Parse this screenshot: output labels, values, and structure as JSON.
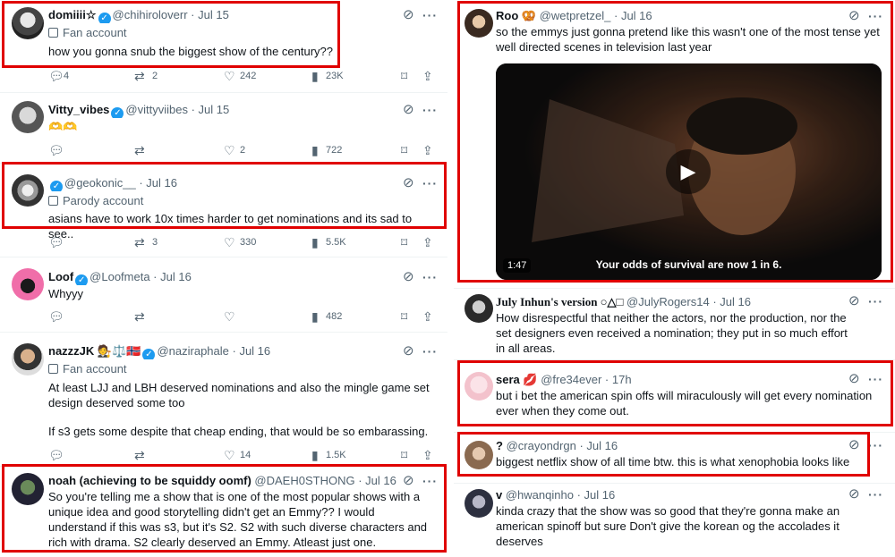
{
  "left": [
    {
      "name": "domiiii☆",
      "handle": "@chihiroloverr",
      "date": "Jul 15",
      "label": "Fan account",
      "text": "how you gonna snub the biggest show of the century??",
      "replies": "4",
      "reposts": "2",
      "likes": "242",
      "views": "23K"
    },
    {
      "name": "Vitty_vibes",
      "handle": "@vittyviibes",
      "date": "Jul 15",
      "text": "🫶🫶",
      "replies": "",
      "reposts": "",
      "likes": "2",
      "views": "722"
    },
    {
      "name": "",
      "handle": "@geokonic__",
      "date": "Jul 16",
      "label": "Parody account",
      "text": "asians have to work 10x times harder to get nominations and its sad to see..",
      "replies": "",
      "reposts": "3",
      "likes": "330",
      "views": "5.5K"
    },
    {
      "name": "Loof",
      "handle": "@Loofmeta",
      "date": "Jul 16",
      "text": "Whyyy",
      "replies": "",
      "reposts": "",
      "likes": "",
      "views": "482"
    },
    {
      "name": "nazzzJK 🧑‍⚖️⚖️🇳🇴",
      "handle": "@naziraphale",
      "date": "Jul 16",
      "label": "Fan account",
      "text": "At least LJJ and LBH deserved nominations and also the mingle game set design deserved some too",
      "text2": "If s3 gets some despite that cheap ending, that would be so embarassing.",
      "replies": "",
      "reposts": "",
      "likes": "14",
      "views": "1.5K"
    },
    {
      "name": "noah (achieving to be squiddy oomf)",
      "handle": "@DAEH0STHONG",
      "date": "Jul 16",
      "text": "So you're telling me a show that is one of the most popular shows  with a unique idea and good storytelling didn't get an Emmy?? I would understand if this was s3, but it's S2. S2 with such diverse characters and rich with drama. S2 clearly deserved an Emmy. Atleast just one."
    }
  ],
  "right": [
    {
      "name": "Roo 🥨",
      "handle": "@wetpretzel_",
      "date": "Jul 16",
      "text": "so the emmys just gonna pretend like this wasn't one of the most tense yet well directed scenes in television last year",
      "video_duration": "1:47",
      "video_caption": "Your odds of survival are now 1 in 6."
    },
    {
      "name": "July Inhun's version ○△□",
      "handle": "@JulyRogers14",
      "date": "Jul 16",
      "text": "How disrespectful that neither the actors, nor the production, nor the set designers even received a nomination; they put in so much effort in all areas."
    },
    {
      "name": "sera 💋",
      "handle": "@fre34ever",
      "date": "17h",
      "text": "but i bet the american spin offs will miraculously will get every nomination ever when they come out."
    },
    {
      "name": "?",
      "handle": "@crayondrgn",
      "date": "Jul 16",
      "text": "biggest netflix show of all time btw. this is what xenophobia looks like"
    },
    {
      "name": "v",
      "handle": "@hwanqinho",
      "date": "Jul 16",
      "text": "kinda crazy that the show was so good that they're gonna make an american spinoff but sure Don't give the korean og the accolades it deserves"
    }
  ],
  "icons": {
    "reply": "reply-icon",
    "repost": "repost-icon",
    "like": "heart-icon",
    "views": "views-icon",
    "bookmark": "bookmark-icon",
    "share": "share-icon",
    "grok": "grok-icon",
    "more": "more-icon"
  },
  "colors": {
    "highlight": "#e00000",
    "verified": "#1d9bf0",
    "muted": "#536471"
  }
}
